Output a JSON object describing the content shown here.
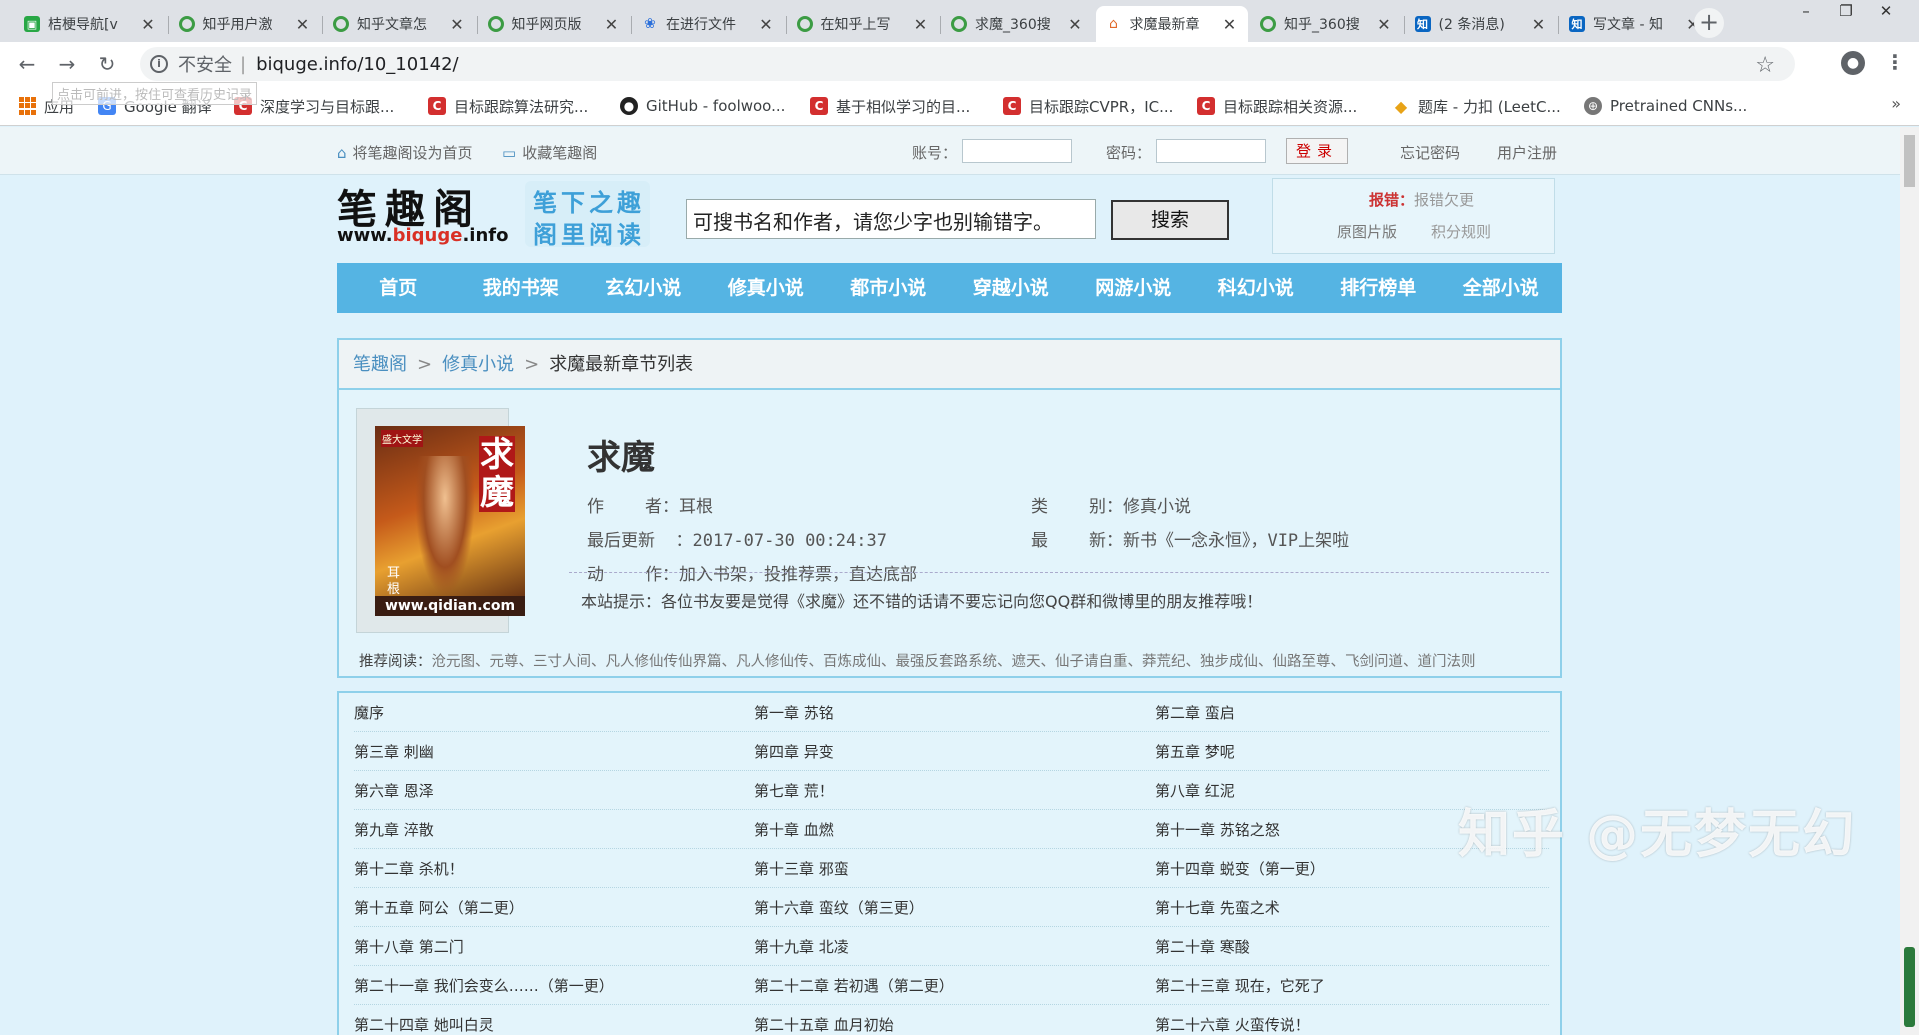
{
  "browser": {
    "tabs": [
      {
        "title": "桔梗导航[v",
        "icon": "green-icon",
        "active": false
      },
      {
        "title": "知乎用户激",
        "icon": "ring-icon",
        "active": false
      },
      {
        "title": "知乎文章怎",
        "icon": "ring-icon",
        "active": false
      },
      {
        "title": "知乎网页版",
        "icon": "ring-icon",
        "active": false
      },
      {
        "title": "在进行文件",
        "icon": "paw-icon",
        "active": false
      },
      {
        "title": "在知乎上写",
        "icon": "ring-icon",
        "active": false
      },
      {
        "title": "求魔_360搜",
        "icon": "ring-icon",
        "active": false
      },
      {
        "title": "求魔最新章",
        "icon": "house-icon",
        "active": true
      },
      {
        "title": "知乎_360搜",
        "icon": "ring-icon",
        "active": false
      },
      {
        "title": "(2 条消息)",
        "icon": "zhihu-icon",
        "active": false
      },
      {
        "title": "写文章 - 知",
        "icon": "zhihu-icon",
        "active": false
      }
    ],
    "address": {
      "insecure_label": "不安全",
      "url": "biquge.info/10_10142/"
    },
    "tooltip": "点击可前进，按住可查看历史记录",
    "bookmarks": [
      {
        "label": "应用",
        "icon": "apps-icon"
      },
      {
        "label": "Google 翻译",
        "icon": "google-translate-icon"
      },
      {
        "label": "深度学习与目标跟...",
        "icon": "csdn-icon"
      },
      {
        "label": "目标跟踪算法研究...",
        "icon": "csdn-icon"
      },
      {
        "label": "GitHub - foolwoo...",
        "icon": "github-icon"
      },
      {
        "label": "基于相似学习的目...",
        "icon": "csdn-icon"
      },
      {
        "label": "目标跟踪CVPR，IC...",
        "icon": "csdn-icon"
      },
      {
        "label": "目标跟踪相关资源...",
        "icon": "csdn-icon"
      },
      {
        "label": "题库 - 力扣 (LeetC...",
        "icon": "leetcode-icon"
      },
      {
        "label": "Pretrained CNNs...",
        "icon": "globe-icon"
      }
    ],
    "bookmarks_more": "»"
  },
  "site": {
    "topbar": {
      "set_home": "将笔趣阁设为首页",
      "favorite": "收藏笔趣阁",
      "account_label": "账号：",
      "password_label": "密码：",
      "login_button": "登录",
      "forgot_password": "忘记密码",
      "register": "用户注册"
    },
    "logo": {
      "main": "笔趣阁",
      "domain_pre": "www.",
      "domain_red": "biquge",
      "domain_post": ".info",
      "slogan1": "笔下之趣",
      "slogan2": "阁里阅读"
    },
    "search": {
      "value": "可搜书名和作者，请您少字也别输错字。",
      "button": "搜索"
    },
    "report": {
      "label": "报错：",
      "text": "报错欠更",
      "link1": "原图片版",
      "link2": "积分规则"
    },
    "nav": [
      "首页",
      "我的书架",
      "玄幻小说",
      "修真小说",
      "都市小说",
      "穿越小说",
      "网游小说",
      "科幻小说",
      "排行榜单",
      "全部小说"
    ]
  },
  "book": {
    "breadcrumb": {
      "home": "笔趣阁",
      "category": "修真小说",
      "current": "求魔最新章节列表",
      "separator": ">"
    },
    "cover": {
      "title_text": "求魔",
      "badge": "盛大文学",
      "author_vertical": "耳根",
      "footer": "www.qidian.com"
    },
    "title": "求魔",
    "author_label": "作    者：",
    "author": "耳根",
    "category_label": "类    别：",
    "category": "修真小说",
    "updated_label": "最后更新  ：",
    "updated": "2017-07-30 00:24:37",
    "latest_label": "最    新：",
    "latest": "新书《一念永恒》，VIP上架啦",
    "actions_label": "动    作：",
    "actions": "加入书架，投推荐票，直达底部",
    "tip": "本站提示：各位书友要是觉得《求魔》还不错的话请不要忘记向您QQ群和微博里的朋友推荐哦！",
    "recommend_label": "推荐阅读：",
    "recommend": "沧元图、元尊、三寸人间、凡人修仙传仙界篇、凡人修仙传、百炼成仙、最强反套路系统、遮天、仙子请自重、莽荒纪、独步成仙、仙路至尊、飞剑问道、道门法则"
  },
  "chapters": [
    [
      "魔序",
      "第一章 苏铭",
      "第二章 蛮启"
    ],
    [
      "第三章 刺幽",
      "第四章 异变",
      "第五章 梦呢"
    ],
    [
      "第六章 恩泽",
      "第七章 荒！",
      "第八章 红泥"
    ],
    [
      "第九章 淬散",
      "第十章 血燃",
      "第十一章 苏铭之怒"
    ],
    [
      "第十二章 杀机！",
      "第十三章 邪蛮",
      "第十四章 蜕变（第一更）"
    ],
    [
      "第十五章 阿公（第二更）",
      "第十六章 蛮纹（第三更）",
      "第十七章 先蛮之术"
    ],
    [
      "第十八章 第二门",
      "第十九章 北凌",
      "第二十章 寒酸"
    ],
    [
      "第二十一章 我们会变么……（第一更）",
      "第二十二章 若初遇（第二更）",
      "第二十三章 现在，它死了"
    ],
    [
      "第二十四章 她叫白灵",
      "第二十五章 血月初始",
      "第二十六章 火蛮传说！"
    ]
  ],
  "watermark": "知乎 @无梦无幻",
  "colors": {
    "nav_bg": "#55b4e3",
    "page_bg": "#dff2fb",
    "border": "#8ed0ea",
    "link": "#4a8fc0"
  }
}
